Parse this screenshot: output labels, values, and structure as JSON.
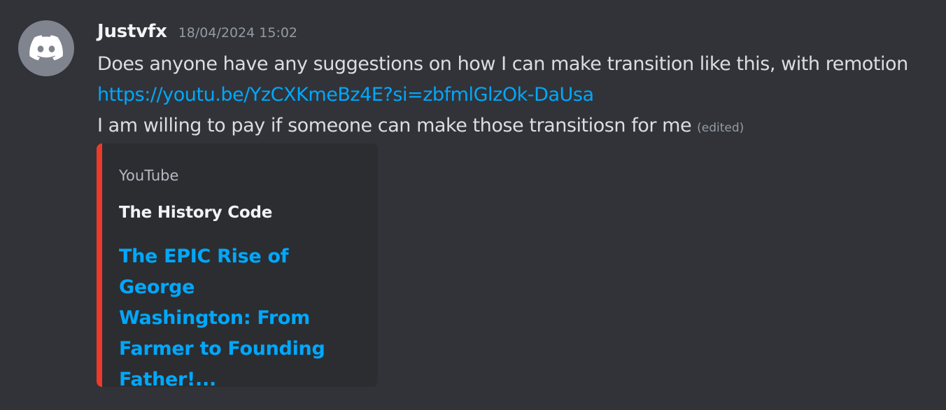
{
  "message": {
    "avatar_icon": "discord-logo-icon",
    "avatar_color": "#80848e",
    "username": "Justvfx",
    "timestamp": "18/04/2024 15:02",
    "lines": [
      "Does anyone have any suggestions on how I can make transition like this, with remotion",
      "https://youtu.be/YzCXKmeBz4E?si=zbfmlGlzOk-DaUsa",
      "I am willing to pay if someone can make those transitiosn for me"
    ],
    "edited_label": "(edited)"
  },
  "embed": {
    "provider": "YouTube",
    "author": "The History Code",
    "title": "The EPIC Rise of George Washington: From Farmer to Founding Father!...",
    "accent_color": "#ee3a2b"
  },
  "colors": {
    "background": "#313338",
    "link": "#00a8fc",
    "muted": "#949ba4"
  }
}
